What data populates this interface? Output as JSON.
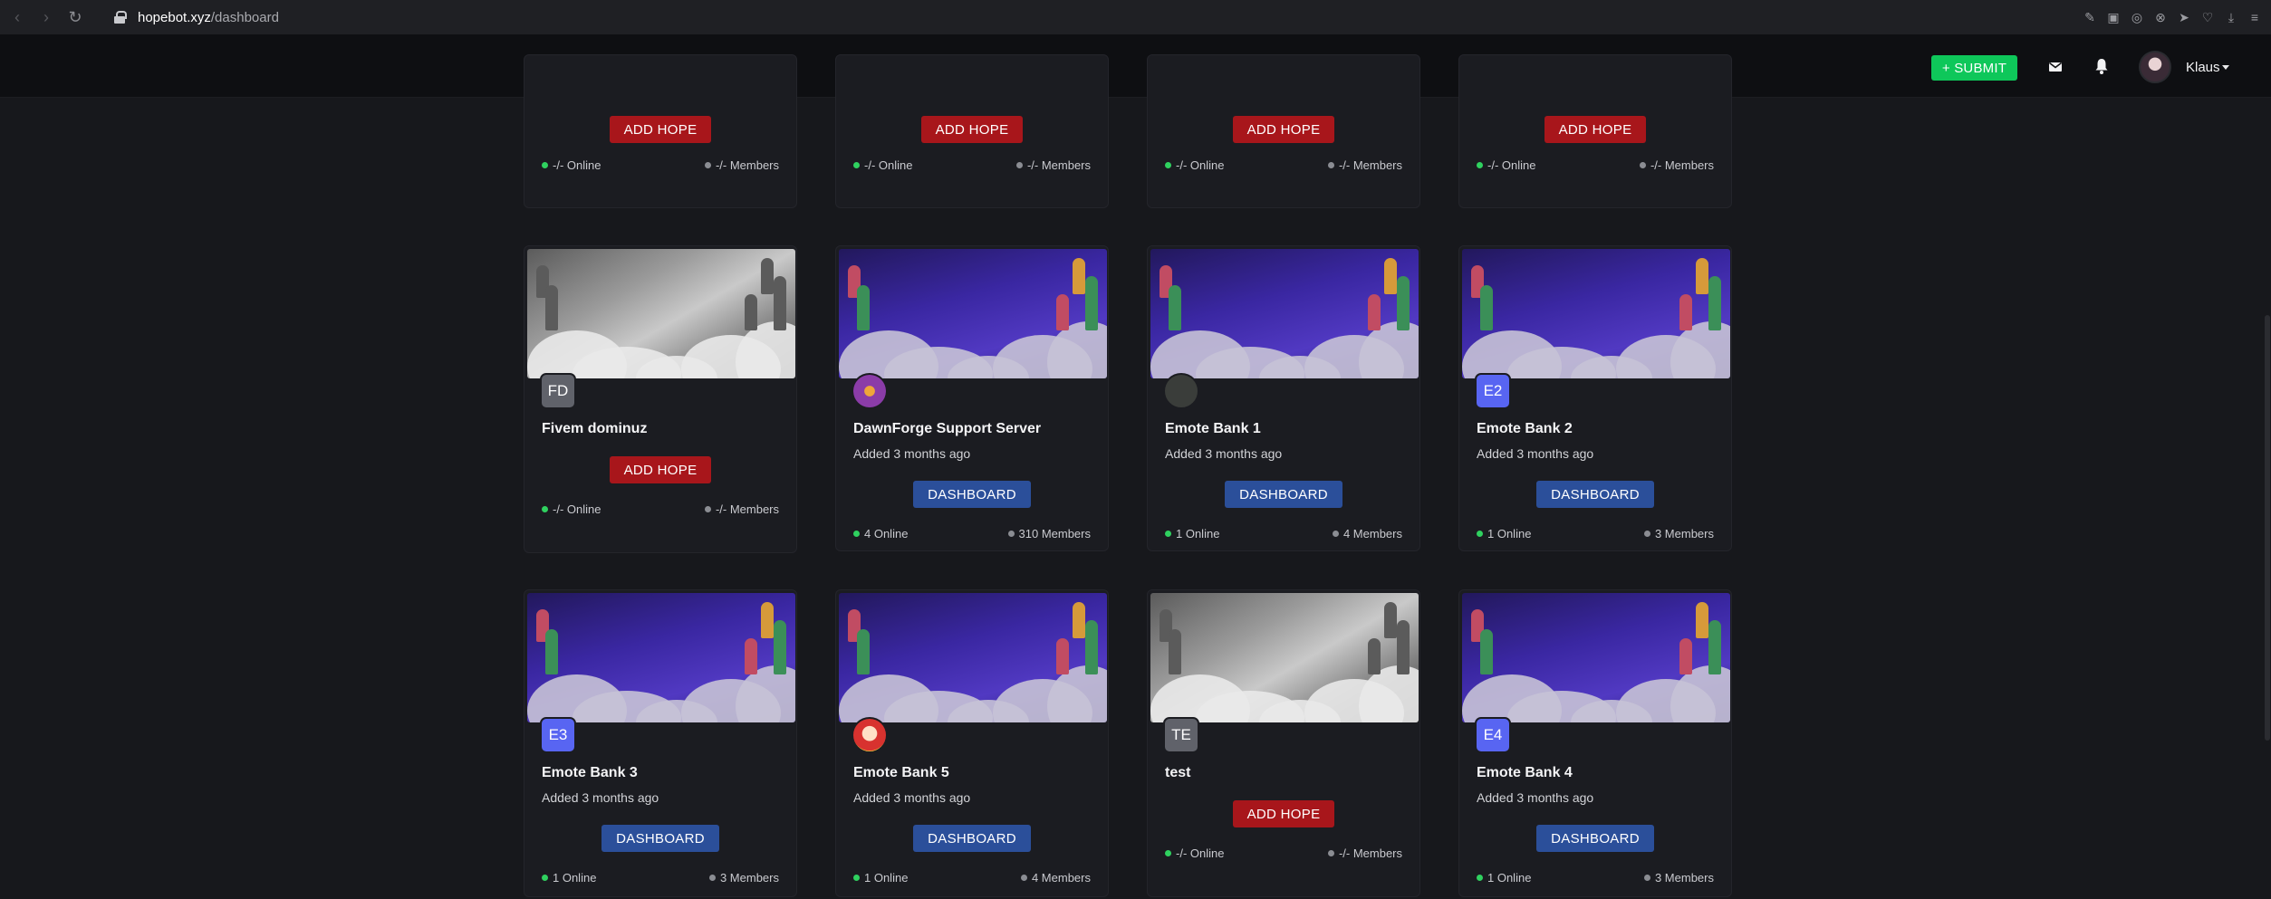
{
  "browser": {
    "url_host": "hopebot.xyz",
    "url_path": "/dashboard"
  },
  "header": {
    "submit_label": "+ SUBMIT",
    "username": "Klaus"
  },
  "top_row": [
    {
      "button": "ADD HOPE",
      "online": "-/- Online",
      "members": "-/- Members"
    },
    {
      "button": "ADD HOPE",
      "online": "-/- Online",
      "members": "-/- Members"
    },
    {
      "button": "ADD HOPE",
      "online": "-/- Online",
      "members": "-/- Members"
    },
    {
      "button": "ADD HOPE",
      "online": "-/- Online",
      "members": "-/- Members"
    }
  ],
  "row2": [
    {
      "name": "Fivem dominuz",
      "icon_text": "FD",
      "icon_style": "grey",
      "banner": "gray",
      "added": "",
      "button": "ADD HOPE",
      "button_type": "add",
      "online": "-/- Online",
      "members": "-/- Members"
    },
    {
      "name": "DawnForge Support Server",
      "icon_text": "",
      "icon_style": "dawn",
      "banner": "purple",
      "added": "Added 3 months ago",
      "button": "DASHBOARD",
      "button_type": "dash",
      "online": "4 Online",
      "members": "310 Members"
    },
    {
      "name": "Emote Bank 1",
      "icon_text": "",
      "icon_style": "emote1",
      "banner": "purple",
      "added": "Added 3 months ago",
      "button": "DASHBOARD",
      "button_type": "dash",
      "online": "1 Online",
      "members": "4 Members"
    },
    {
      "name": "Emote Bank 2",
      "icon_text": "E2",
      "icon_style": "blurple",
      "banner": "purple",
      "added": "Added 3 months ago",
      "button": "DASHBOARD",
      "button_type": "dash",
      "online": "1 Online",
      "members": "3 Members"
    }
  ],
  "row3": [
    {
      "name": "Emote Bank 3",
      "icon_text": "E3",
      "icon_style": "blurple",
      "banner": "purple",
      "added": "Added 3 months ago",
      "button": "DASHBOARD",
      "button_type": "dash",
      "online": "1 Online",
      "members": "3 Members"
    },
    {
      "name": "Emote Bank 5",
      "icon_text": "",
      "icon_style": "emote5",
      "banner": "purple",
      "added": "Added 3 months ago",
      "button": "DASHBOARD",
      "button_type": "dash",
      "online": "1 Online",
      "members": "4 Members"
    },
    {
      "name": "test",
      "icon_text": "TE",
      "icon_style": "grey",
      "banner": "gray",
      "added": "",
      "button": "ADD HOPE",
      "button_type": "add",
      "online": "-/- Online",
      "members": "-/- Members"
    },
    {
      "name": "Emote Bank 4",
      "icon_text": "E4",
      "icon_style": "blurple",
      "banner": "purple",
      "added": "Added 3 months ago",
      "button": "DASHBOARD",
      "button_type": "dash",
      "online": "1 Online",
      "members": "3 Members"
    }
  ],
  "colors": {
    "submit": "#0ec75a",
    "add_hope": "#a8161b",
    "dashboard": "#2b4f9a",
    "online_dot": "#2fd15f"
  }
}
